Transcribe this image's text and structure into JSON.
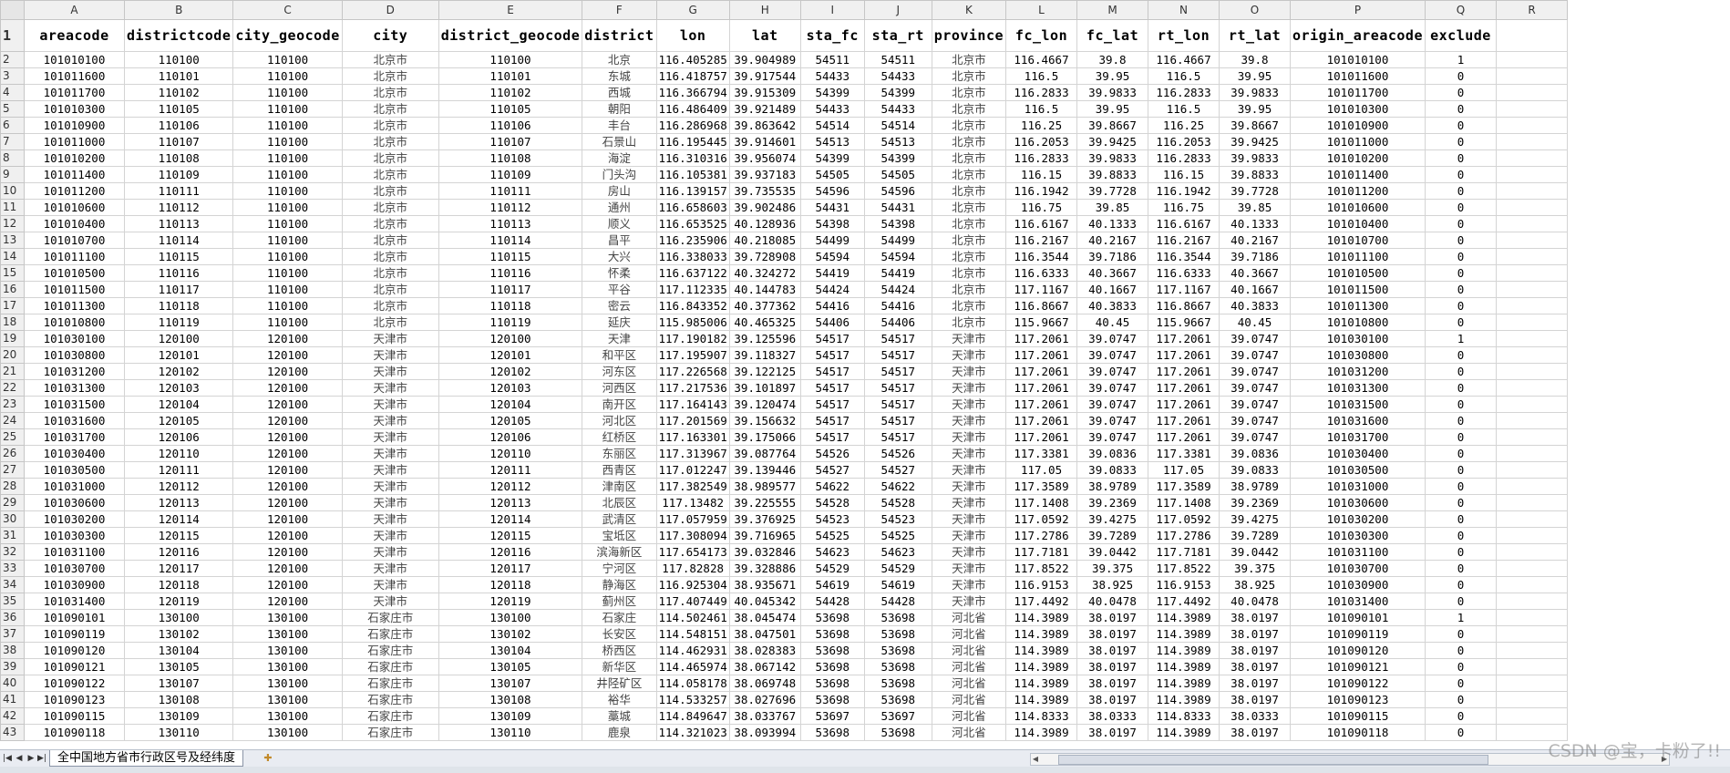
{
  "spreadsheet": {
    "column_letters": [
      "A",
      "B",
      "C",
      "D",
      "E",
      "F",
      "G",
      "H",
      "I",
      "J",
      "K",
      "L",
      "M",
      "N",
      "O",
      "P",
      "Q",
      "R"
    ],
    "headers": [
      "areacode",
      "districtcode",
      "city_geocode",
      "city",
      "district_geocode",
      "district",
      "lon",
      "lat",
      "sta_fc",
      "sta_rt",
      "province",
      "fc_lon",
      "fc_lat",
      "rt_lon",
      "rt_lat",
      "origin_areacode",
      "exclude",
      ""
    ],
    "rows": [
      [
        "101010100",
        "110100",
        "110100",
        "北京市",
        "110100",
        "北京",
        "116.405285",
        "39.904989",
        "54511",
        "54511",
        "北京市",
        "116.4667",
        "39.8",
        "116.4667",
        "39.8",
        "101010100",
        "1"
      ],
      [
        "101011600",
        "110101",
        "110100",
        "北京市",
        "110101",
        "东城",
        "116.418757",
        "39.917544",
        "54433",
        "54433",
        "北京市",
        "116.5",
        "39.95",
        "116.5",
        "39.95",
        "101011600",
        "0"
      ],
      [
        "101011700",
        "110102",
        "110100",
        "北京市",
        "110102",
        "西城",
        "116.366794",
        "39.915309",
        "54399",
        "54399",
        "北京市",
        "116.2833",
        "39.9833",
        "116.2833",
        "39.9833",
        "101011700",
        "0"
      ],
      [
        "101010300",
        "110105",
        "110100",
        "北京市",
        "110105",
        "朝阳",
        "116.486409",
        "39.921489",
        "54433",
        "54433",
        "北京市",
        "116.5",
        "39.95",
        "116.5",
        "39.95",
        "101010300",
        "0"
      ],
      [
        "101010900",
        "110106",
        "110100",
        "北京市",
        "110106",
        "丰台",
        "116.286968",
        "39.863642",
        "54514",
        "54514",
        "北京市",
        "116.25",
        "39.8667",
        "116.25",
        "39.8667",
        "101010900",
        "0"
      ],
      [
        "101011000",
        "110107",
        "110100",
        "北京市",
        "110107",
        "石景山",
        "116.195445",
        "39.914601",
        "54513",
        "54513",
        "北京市",
        "116.2053",
        "39.9425",
        "116.2053",
        "39.9425",
        "101011000",
        "0"
      ],
      [
        "101010200",
        "110108",
        "110100",
        "北京市",
        "110108",
        "海淀",
        "116.310316",
        "39.956074",
        "54399",
        "54399",
        "北京市",
        "116.2833",
        "39.9833",
        "116.2833",
        "39.9833",
        "101010200",
        "0"
      ],
      [
        "101011400",
        "110109",
        "110100",
        "北京市",
        "110109",
        "门头沟",
        "116.105381",
        "39.937183",
        "54505",
        "54505",
        "北京市",
        "116.15",
        "39.8833",
        "116.15",
        "39.8833",
        "101011400",
        "0"
      ],
      [
        "101011200",
        "110111",
        "110100",
        "北京市",
        "110111",
        "房山",
        "116.139157",
        "39.735535",
        "54596",
        "54596",
        "北京市",
        "116.1942",
        "39.7728",
        "116.1942",
        "39.7728",
        "101011200",
        "0"
      ],
      [
        "101010600",
        "110112",
        "110100",
        "北京市",
        "110112",
        "通州",
        "116.658603",
        "39.902486",
        "54431",
        "54431",
        "北京市",
        "116.75",
        "39.85",
        "116.75",
        "39.85",
        "101010600",
        "0"
      ],
      [
        "101010400",
        "110113",
        "110100",
        "北京市",
        "110113",
        "顺义",
        "116.653525",
        "40.128936",
        "54398",
        "54398",
        "北京市",
        "116.6167",
        "40.1333",
        "116.6167",
        "40.1333",
        "101010400",
        "0"
      ],
      [
        "101010700",
        "110114",
        "110100",
        "北京市",
        "110114",
        "昌平",
        "116.235906",
        "40.218085",
        "54499",
        "54499",
        "北京市",
        "116.2167",
        "40.2167",
        "116.2167",
        "40.2167",
        "101010700",
        "0"
      ],
      [
        "101011100",
        "110115",
        "110100",
        "北京市",
        "110115",
        "大兴",
        "116.338033",
        "39.728908",
        "54594",
        "54594",
        "北京市",
        "116.3544",
        "39.7186",
        "116.3544",
        "39.7186",
        "101011100",
        "0"
      ],
      [
        "101010500",
        "110116",
        "110100",
        "北京市",
        "110116",
        "怀柔",
        "116.637122",
        "40.324272",
        "54419",
        "54419",
        "北京市",
        "116.6333",
        "40.3667",
        "116.6333",
        "40.3667",
        "101010500",
        "0"
      ],
      [
        "101011500",
        "110117",
        "110100",
        "北京市",
        "110117",
        "平谷",
        "117.112335",
        "40.144783",
        "54424",
        "54424",
        "北京市",
        "117.1167",
        "40.1667",
        "117.1167",
        "40.1667",
        "101011500",
        "0"
      ],
      [
        "101011300",
        "110118",
        "110100",
        "北京市",
        "110118",
        "密云",
        "116.843352",
        "40.377362",
        "54416",
        "54416",
        "北京市",
        "116.8667",
        "40.3833",
        "116.8667",
        "40.3833",
        "101011300",
        "0"
      ],
      [
        "101010800",
        "110119",
        "110100",
        "北京市",
        "110119",
        "延庆",
        "115.985006",
        "40.465325",
        "54406",
        "54406",
        "北京市",
        "115.9667",
        "40.45",
        "115.9667",
        "40.45",
        "101010800",
        "0"
      ],
      [
        "101030100",
        "120100",
        "120100",
        "天津市",
        "120100",
        "天津",
        "117.190182",
        "39.125596",
        "54517",
        "54517",
        "天津市",
        "117.2061",
        "39.0747",
        "117.2061",
        "39.0747",
        "101030100",
        "1"
      ],
      [
        "101030800",
        "120101",
        "120100",
        "天津市",
        "120101",
        "和平区",
        "117.195907",
        "39.118327",
        "54517",
        "54517",
        "天津市",
        "117.2061",
        "39.0747",
        "117.2061",
        "39.0747",
        "101030800",
        "0"
      ],
      [
        "101031200",
        "120102",
        "120100",
        "天津市",
        "120102",
        "河东区",
        "117.226568",
        "39.122125",
        "54517",
        "54517",
        "天津市",
        "117.2061",
        "39.0747",
        "117.2061",
        "39.0747",
        "101031200",
        "0"
      ],
      [
        "101031300",
        "120103",
        "120100",
        "天津市",
        "120103",
        "河西区",
        "117.217536",
        "39.101897",
        "54517",
        "54517",
        "天津市",
        "117.2061",
        "39.0747",
        "117.2061",
        "39.0747",
        "101031300",
        "0"
      ],
      [
        "101031500",
        "120104",
        "120100",
        "天津市",
        "120104",
        "南开区",
        "117.164143",
        "39.120474",
        "54517",
        "54517",
        "天津市",
        "117.2061",
        "39.0747",
        "117.2061",
        "39.0747",
        "101031500",
        "0"
      ],
      [
        "101031600",
        "120105",
        "120100",
        "天津市",
        "120105",
        "河北区",
        "117.201569",
        "39.156632",
        "54517",
        "54517",
        "天津市",
        "117.2061",
        "39.0747",
        "117.2061",
        "39.0747",
        "101031600",
        "0"
      ],
      [
        "101031700",
        "120106",
        "120100",
        "天津市",
        "120106",
        "红桥区",
        "117.163301",
        "39.175066",
        "54517",
        "54517",
        "天津市",
        "117.2061",
        "39.0747",
        "117.2061",
        "39.0747",
        "101031700",
        "0"
      ],
      [
        "101030400",
        "120110",
        "120100",
        "天津市",
        "120110",
        "东丽区",
        "117.313967",
        "39.087764",
        "54526",
        "54526",
        "天津市",
        "117.3381",
        "39.0836",
        "117.3381",
        "39.0836",
        "101030400",
        "0"
      ],
      [
        "101030500",
        "120111",
        "120100",
        "天津市",
        "120111",
        "西青区",
        "117.012247",
        "39.139446",
        "54527",
        "54527",
        "天津市",
        "117.05",
        "39.0833",
        "117.05",
        "39.0833",
        "101030500",
        "0"
      ],
      [
        "101031000",
        "120112",
        "120100",
        "天津市",
        "120112",
        "津南区",
        "117.382549",
        "38.989577",
        "54622",
        "54622",
        "天津市",
        "117.3589",
        "38.9789",
        "117.3589",
        "38.9789",
        "101031000",
        "0"
      ],
      [
        "101030600",
        "120113",
        "120100",
        "天津市",
        "120113",
        "北辰区",
        "117.13482",
        "39.225555",
        "54528",
        "54528",
        "天津市",
        "117.1408",
        "39.2369",
        "117.1408",
        "39.2369",
        "101030600",
        "0"
      ],
      [
        "101030200",
        "120114",
        "120100",
        "天津市",
        "120114",
        "武清区",
        "117.057959",
        "39.376925",
        "54523",
        "54523",
        "天津市",
        "117.0592",
        "39.4275",
        "117.0592",
        "39.4275",
        "101030200",
        "0"
      ],
      [
        "101030300",
        "120115",
        "120100",
        "天津市",
        "120115",
        "宝坻区",
        "117.308094",
        "39.716965",
        "54525",
        "54525",
        "天津市",
        "117.2786",
        "39.7289",
        "117.2786",
        "39.7289",
        "101030300",
        "0"
      ],
      [
        "101031100",
        "120116",
        "120100",
        "天津市",
        "120116",
        "滨海新区",
        "117.654173",
        "39.032846",
        "54623",
        "54623",
        "天津市",
        "117.7181",
        "39.0442",
        "117.7181",
        "39.0442",
        "101031100",
        "0"
      ],
      [
        "101030700",
        "120117",
        "120100",
        "天津市",
        "120117",
        "宁河区",
        "117.82828",
        "39.328886",
        "54529",
        "54529",
        "天津市",
        "117.8522",
        "39.375",
        "117.8522",
        "39.375",
        "101030700",
        "0"
      ],
      [
        "101030900",
        "120118",
        "120100",
        "天津市",
        "120118",
        "静海区",
        "116.925304",
        "38.935671",
        "54619",
        "54619",
        "天津市",
        "116.9153",
        "38.925",
        "116.9153",
        "38.925",
        "101030900",
        "0"
      ],
      [
        "101031400",
        "120119",
        "120100",
        "天津市",
        "120119",
        "蓟州区",
        "117.407449",
        "40.045342",
        "54428",
        "54428",
        "天津市",
        "117.4492",
        "40.0478",
        "117.4492",
        "40.0478",
        "101031400",
        "0"
      ],
      [
        "101090101",
        "130100",
        "130100",
        "石家庄市",
        "130100",
        "石家庄",
        "114.502461",
        "38.045474",
        "53698",
        "53698",
        "河北省",
        "114.3989",
        "38.0197",
        "114.3989",
        "38.0197",
        "101090101",
        "1"
      ],
      [
        "101090119",
        "130102",
        "130100",
        "石家庄市",
        "130102",
        "长安区",
        "114.548151",
        "38.047501",
        "53698",
        "53698",
        "河北省",
        "114.3989",
        "38.0197",
        "114.3989",
        "38.0197",
        "101090119",
        "0"
      ],
      [
        "101090120",
        "130104",
        "130100",
        "石家庄市",
        "130104",
        "桥西区",
        "114.462931",
        "38.028383",
        "53698",
        "53698",
        "河北省",
        "114.3989",
        "38.0197",
        "114.3989",
        "38.0197",
        "101090120",
        "0"
      ],
      [
        "101090121",
        "130105",
        "130100",
        "石家庄市",
        "130105",
        "新华区",
        "114.465974",
        "38.067142",
        "53698",
        "53698",
        "河北省",
        "114.3989",
        "38.0197",
        "114.3989",
        "38.0197",
        "101090121",
        "0"
      ],
      [
        "101090122",
        "130107",
        "130100",
        "石家庄市",
        "130107",
        "井陉矿区",
        "114.058178",
        "38.069748",
        "53698",
        "53698",
        "河北省",
        "114.3989",
        "38.0197",
        "114.3989",
        "38.0197",
        "101090122",
        "0"
      ],
      [
        "101090123",
        "130108",
        "130100",
        "石家庄市",
        "130108",
        "裕华",
        "114.533257",
        "38.027696",
        "53698",
        "53698",
        "河北省",
        "114.3989",
        "38.0197",
        "114.3989",
        "38.0197",
        "101090123",
        "0"
      ],
      [
        "101090115",
        "130109",
        "130100",
        "石家庄市",
        "130109",
        "藁城",
        "114.849647",
        "38.033767",
        "53697",
        "53697",
        "河北省",
        "114.8333",
        "38.0333",
        "114.8333",
        "38.0333",
        "101090115",
        "0"
      ],
      [
        "101090118",
        "130110",
        "130100",
        "石家庄市",
        "130110",
        "鹿泉",
        "114.321023",
        "38.093994",
        "53698",
        "53698",
        "河北省",
        "114.3989",
        "38.0197",
        "114.3989",
        "38.0197",
        "101090118",
        "0"
      ]
    ]
  },
  "sheet_tab": "全中国地方省市行政区号及经纬度",
  "watermark": "CSDN @宝，卡粉了!!"
}
